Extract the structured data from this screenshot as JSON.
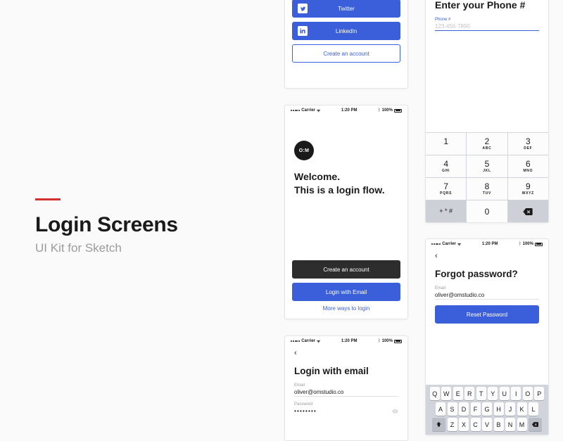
{
  "hero": {
    "title": "Login Screens",
    "subtitle": "UI Kit for Sketch"
  },
  "status": {
    "carrier": "Carrier",
    "time": "1:20 PM",
    "battery": "100%"
  },
  "social": {
    "twitter": "Twitter",
    "linkedin": "LinkedIn",
    "create": "Create an account"
  },
  "welcome": {
    "line1": "Welcome.",
    "line2": "This is a login flow.",
    "create": "Create an account",
    "login": "Login with Email",
    "more": "More ways to login"
  },
  "loginEmail": {
    "title": "Login with email",
    "emailLabel": "Email",
    "emailValue": "oliver@omstudio.co",
    "passwordLabel": "Password",
    "passwordDots": "••••••••"
  },
  "phone": {
    "title": "Enter your Phone #",
    "label": "Phone #",
    "placeholder": "123-456-7890",
    "keys": [
      {
        "n": "1",
        "s": ""
      },
      {
        "n": "2",
        "s": "ABC"
      },
      {
        "n": "3",
        "s": "DEF"
      },
      {
        "n": "4",
        "s": "GHI"
      },
      {
        "n": "5",
        "s": "JKL"
      },
      {
        "n": "6",
        "s": "MNO"
      },
      {
        "n": "7",
        "s": "PQRS"
      },
      {
        "n": "8",
        "s": "TUV"
      },
      {
        "n": "9",
        "s": "WXYZ"
      }
    ],
    "sym": "+ * #",
    "zero": "0"
  },
  "forgot": {
    "title": "Forgot password?",
    "emailLabel": "Email",
    "emailValue": "oliver@omstudio.co",
    "reset": "Reset Password"
  },
  "qwerty": {
    "r1": [
      "Q",
      "W",
      "E",
      "R",
      "T",
      "Y",
      "U",
      "I",
      "O",
      "P"
    ],
    "r2": [
      "A",
      "S",
      "D",
      "F",
      "G",
      "H",
      "J",
      "K",
      "L"
    ],
    "r3": [
      "Z",
      "X",
      "C",
      "V",
      "B",
      "N",
      "M"
    ]
  }
}
